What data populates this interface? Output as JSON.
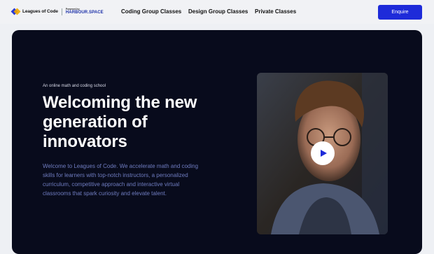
{
  "header": {
    "logo_text": "Leagues of Code",
    "powered_by": "Powered by",
    "partner": "HARBOUR.SPACE",
    "nav": [
      "Coding Group Classes",
      "Design Group Classes",
      "Private Classes"
    ],
    "cta": "Enquire"
  },
  "hero": {
    "eyebrow": "An online math and coding school",
    "title": "Welcoming the new generation of innovators",
    "description": "Welcome to Leagues of Code. We accelerate math and coding skills for learners with top-notch instructors, a personalized curriculum, competitive approach and interactive virtual classrooms that spark curiosity and elevate talent.",
    "video_icon": "play-icon"
  },
  "colors": {
    "accent": "#1e2bd9",
    "hero_bg": "#080b1c",
    "desc_text": "#6f7cc0"
  }
}
